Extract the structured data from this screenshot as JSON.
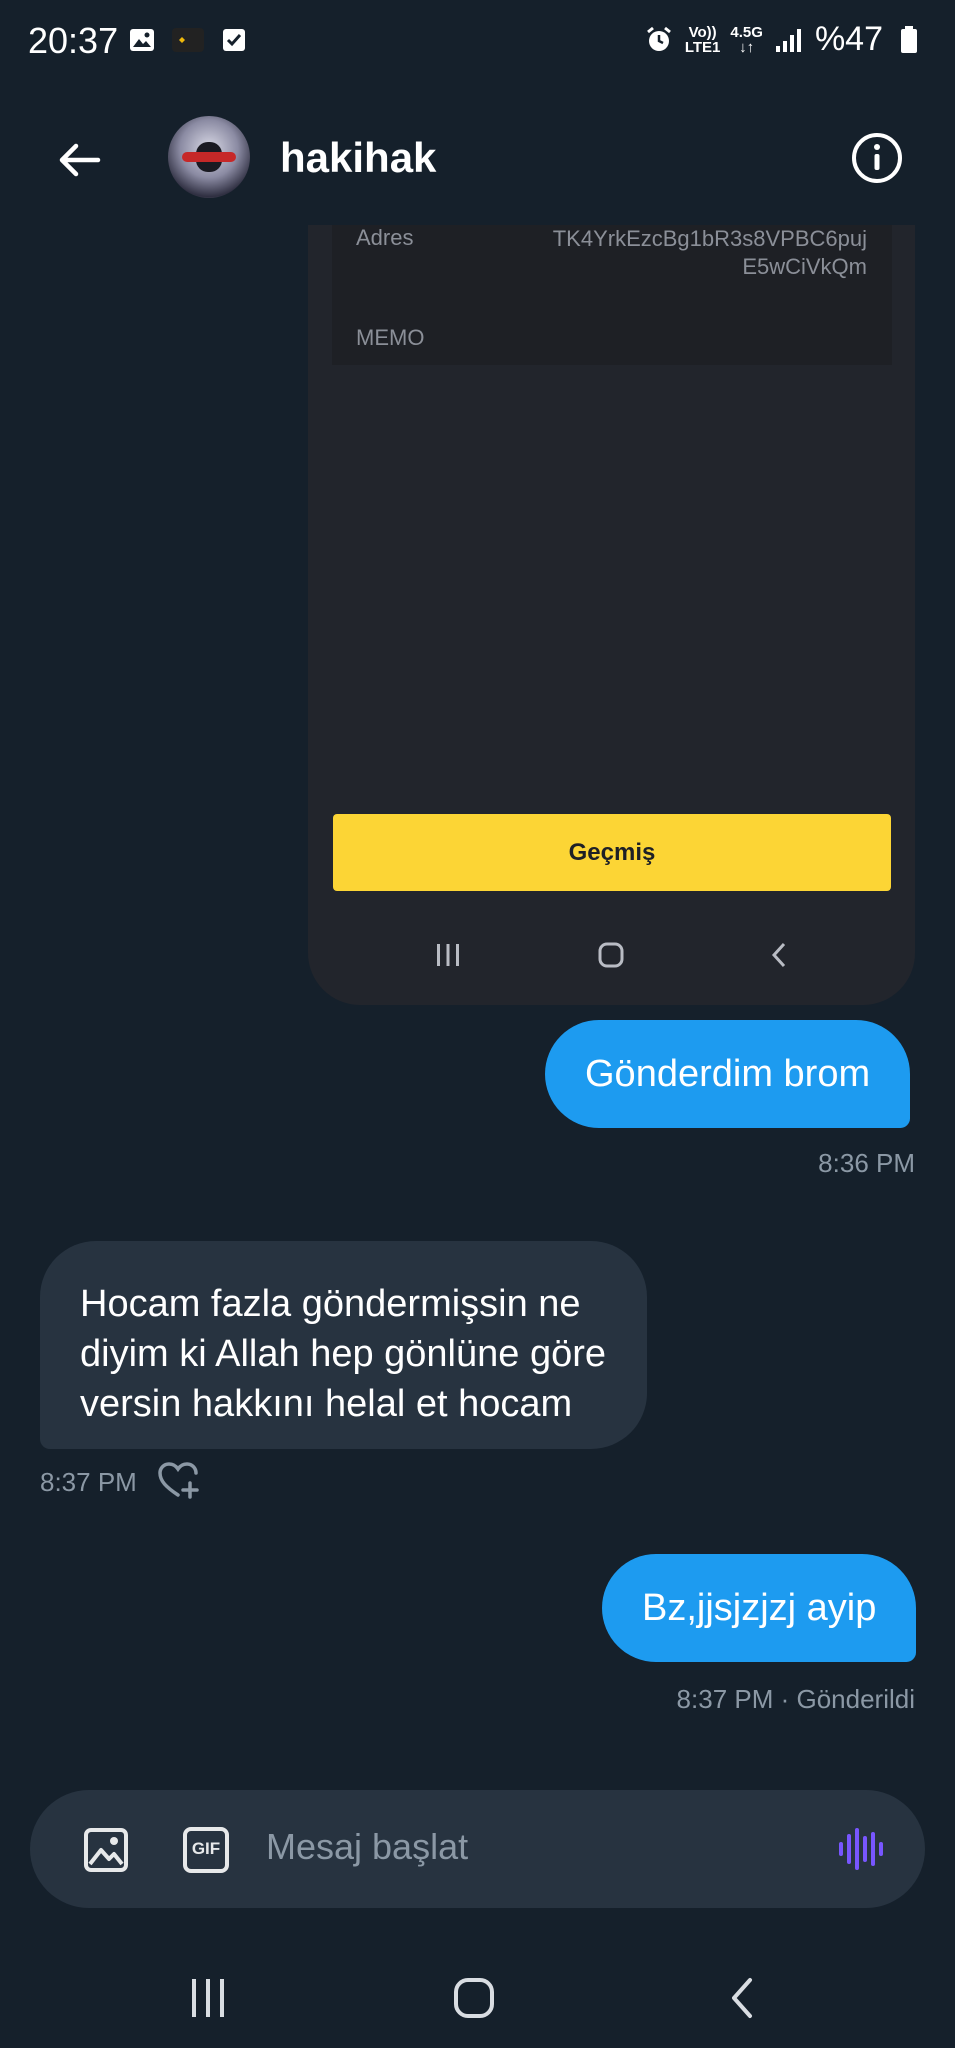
{
  "status_bar": {
    "time": "20:37",
    "network_top": "Vo))",
    "network_bottom": "LTE1",
    "data_type": "4.5G",
    "battery": "%47",
    "icons": [
      "gallery-icon",
      "exchange-tr-icon",
      "checkbox-icon",
      "alarm-icon",
      "signal-icon",
      "battery-icon"
    ]
  },
  "header": {
    "username": "hakihak",
    "back_icon": "arrow-left-icon",
    "info_icon": "info-circle-icon"
  },
  "shared_screenshot": {
    "address_label": "Adres",
    "address_value": "TK4YrkEzcBg1bR3s8VPBC6pujE5wCiVkQm",
    "memo_label": "MEMO",
    "history_button": "Geçmiş"
  },
  "messages": [
    {
      "direction": "sent",
      "text": "Gönderdim brom",
      "meta": "8:36 PM"
    },
    {
      "direction": "received",
      "lines": [
        "Hocam fazla göndermişsin ne",
        "diyim ki Allah hep gönlüne göre",
        "versin hakkını helal et hocam"
      ],
      "meta": "8:37 PM"
    },
    {
      "direction": "sent",
      "text": "Bz,jjsjzjzj ayip",
      "meta": "8:37 PM · Gönderildi"
    }
  ],
  "composer": {
    "placeholder": "Mesaj başlat",
    "gif_label": "GIF"
  },
  "colors": {
    "background": "#15202b",
    "sent_bubble": "#1d9bf0",
    "received_bubble": "#273340",
    "accent_voice": "#7856ff",
    "history_button": "#fcd535"
  }
}
